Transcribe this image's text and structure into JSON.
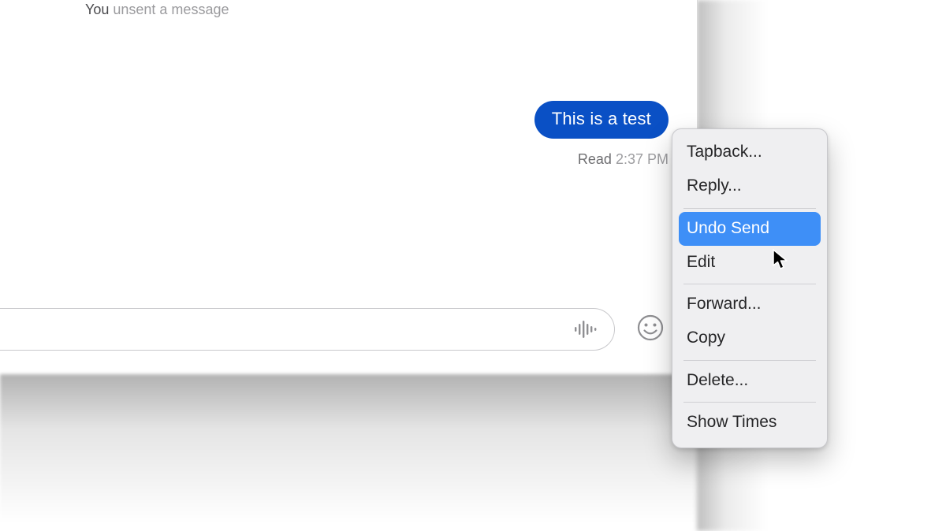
{
  "colors": {
    "bubble_bg": "#0a50c5",
    "menu_highlight": "#3e8ff7"
  },
  "status_line": {
    "prefix": "You",
    "rest": " unsent a message"
  },
  "message": {
    "text": "This is a test",
    "receipt_status": "Read",
    "receipt_time": "2:37 PM"
  },
  "compose": {
    "placeholder": "",
    "audio_icon": "audio-memo-icon",
    "emoji_icon": "smiley-icon"
  },
  "context_menu": {
    "items": [
      {
        "label": "Tapback...",
        "highlighted": false
      },
      {
        "label": "Reply...",
        "highlighted": false
      },
      {
        "sep": true
      },
      {
        "label": "Undo Send",
        "highlighted": true
      },
      {
        "label": "Edit",
        "highlighted": false
      },
      {
        "sep": true
      },
      {
        "label": "Forward...",
        "highlighted": false
      },
      {
        "label": "Copy",
        "highlighted": false
      },
      {
        "sep": true
      },
      {
        "label": "Delete...",
        "highlighted": false
      },
      {
        "sep": true
      },
      {
        "label": "Show Times",
        "highlighted": false
      }
    ]
  }
}
